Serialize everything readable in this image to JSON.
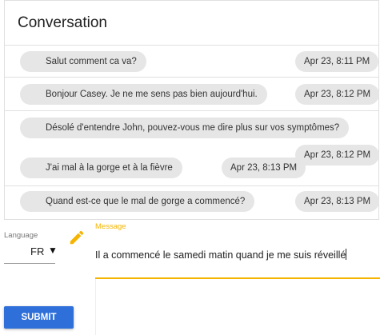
{
  "conversation": {
    "title": "Conversation",
    "messages": [
      {
        "text": "Salut comment ca va?",
        "time": "Apr 23, 8:11 PM",
        "avatar_icon": "patient-avatar-icon"
      },
      {
        "text": "Bonjour Casey. Je ne me sens pas bien aujourd'hui.",
        "time": "Apr 23, 8:12 PM",
        "avatar_icon": "doctor-avatar-icon"
      },
      {
        "text": "Désolé d'entendre John, pouvez-vous me dire plus sur vos symptômes?",
        "time": "Apr 23, 8:12 PM",
        "avatar_icon": "patient-avatar-icon"
      },
      {
        "text": "J'ai mal à la gorge et à la fièvre",
        "time": "Apr 23, 8:13 PM",
        "avatar_icon": "doctor-avatar-icon"
      },
      {
        "text": "Quand est-ce que le mal de gorge a commencé?",
        "time": "Apr 23, 8:13 PM",
        "avatar_icon": "patient-avatar-icon"
      }
    ]
  },
  "language": {
    "label": "Language",
    "selected": "FR"
  },
  "message_input": {
    "label": "Message",
    "value": "Il a commencé le samedi matin quand je me suis réveillé"
  },
  "submit_label": "SUBMIT",
  "colors": {
    "accent": "#f5b400",
    "button": "#2e6fd9",
    "chip": "#e6e6e6"
  }
}
